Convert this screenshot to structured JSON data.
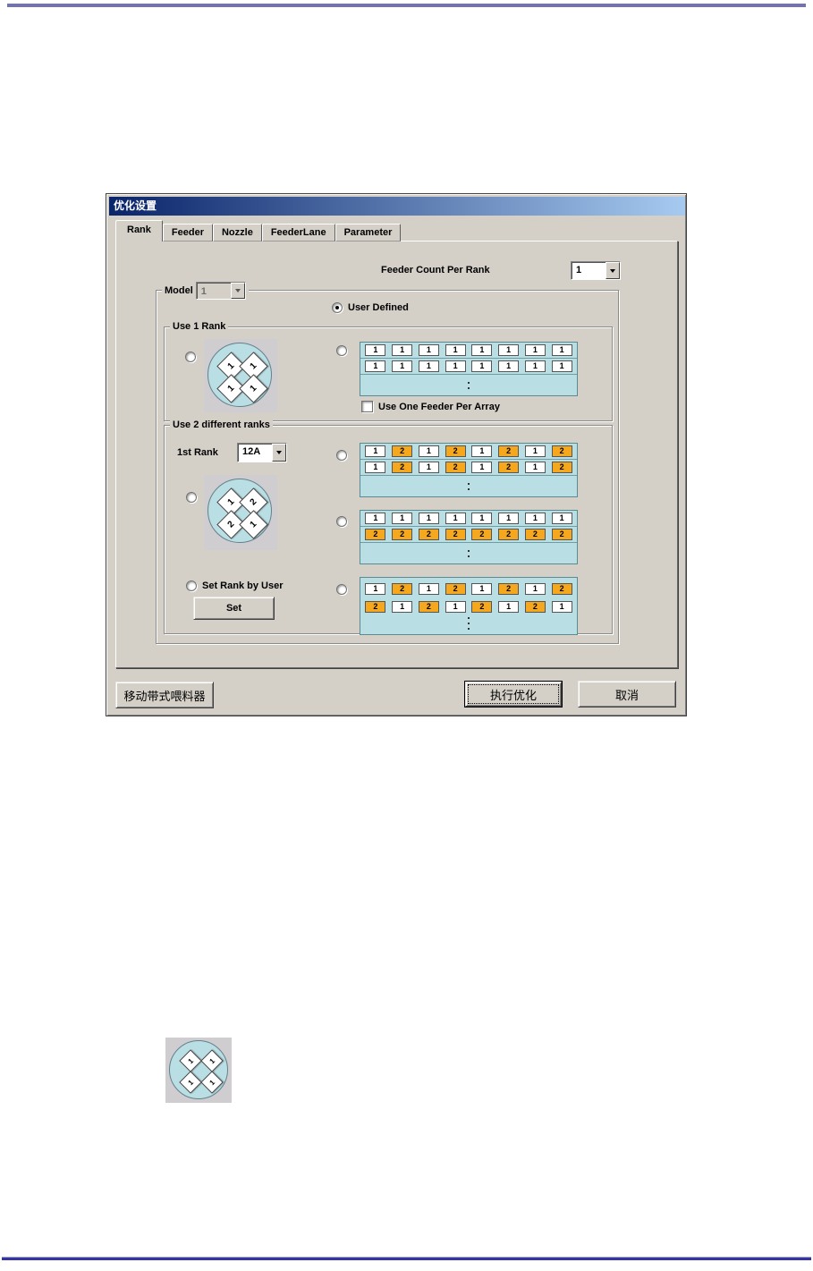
{
  "colors": {
    "dialog_bg": "#d4d0c8",
    "array_bg": "#b9dfe4",
    "circle_bg": "#b9dfe4",
    "cell_one_bg": "#ffffff",
    "cell_two_bg": "#f5a81e",
    "title_grad_left": "#0a246a",
    "title_grad_right": "#a6caf0",
    "top_rule": "#7474ac",
    "bottom_rule": "#3434a4"
  },
  "dialog": {
    "title": "优化设置",
    "tabs": [
      "Rank",
      "Feeder",
      "Nozzle",
      "FeederLane",
      "Parameter"
    ],
    "active_tab": "Rank",
    "feeder_count": {
      "label": "Feeder Count Per Rank",
      "value": "1"
    },
    "model": {
      "label": "Model",
      "value": "1",
      "user_defined_label": "User Defined",
      "user_defined_checked": true,
      "use_one_rank": {
        "label": "Use 1 Rank",
        "radio_circle_checked": false,
        "radio_array_checked": false,
        "circle_diamonds": [
          "1",
          "1",
          "1",
          "1"
        ],
        "array_rows": [
          [
            "1",
            "1",
            "1",
            "1",
            "1",
            "1",
            "1",
            "1"
          ],
          [
            "1",
            "1",
            "1",
            "1",
            "1",
            "1",
            "1",
            "1"
          ]
        ],
        "checkbox_label": "Use One Feeder Per Array",
        "checkbox_checked": false
      },
      "use_two_ranks": {
        "label": "Use 2 different ranks",
        "first_rank": {
          "label": "1st Rank",
          "value": "12A"
        },
        "radio_alt_checked": false,
        "alt_array_rows": [
          [
            "1",
            "2",
            "1",
            "2",
            "1",
            "2",
            "1",
            "2"
          ],
          [
            "1",
            "2",
            "1",
            "2",
            "1",
            "2",
            "1",
            "2"
          ]
        ],
        "radio_circle_checked": false,
        "circle_diamonds": [
          "1",
          "2",
          "2",
          "1"
        ],
        "radio_split_checked": false,
        "split_array_rows": [
          [
            "1",
            "1",
            "1",
            "1",
            "1",
            "1",
            "1",
            "1"
          ],
          [
            "2",
            "2",
            "2",
            "2",
            "2",
            "2",
            "2",
            "2"
          ]
        ],
        "set_rank_label": "Set Rank by User",
        "radio_set_checked": false,
        "set_button_label": "Set",
        "radio_custom_checked": false,
        "custom_array_rows": [
          [
            "1",
            "2",
            "1",
            "2",
            "1",
            "2",
            "1",
            "2"
          ],
          [
            "2",
            "1",
            "2",
            "1",
            "2",
            "1",
            "2",
            "1"
          ]
        ]
      }
    },
    "buttons": {
      "move_feeder": "移动带式喂料器",
      "run": "执行优化",
      "cancel": "取消"
    }
  },
  "figure": {
    "circle_diamonds": [
      "1",
      "1",
      "1",
      "1"
    ]
  }
}
